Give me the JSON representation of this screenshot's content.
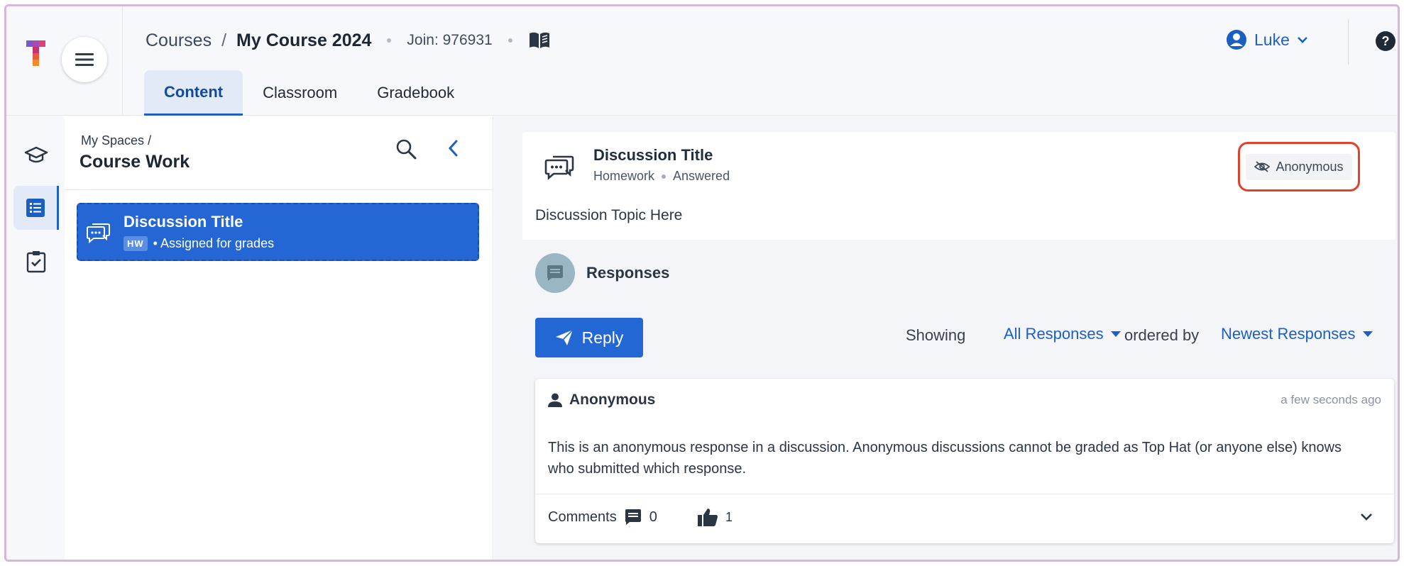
{
  "header": {
    "breadcrumb_courses": "Courses",
    "breadcrumb_sep": "/",
    "course_name": "My Course 2024",
    "join_label": "Join: 976931",
    "user_name": "Luke",
    "icons": [
      "menu-icon",
      "book-icon",
      "user-circle-icon",
      "chevron-down-icon",
      "help-icon"
    ]
  },
  "tabs": [
    {
      "label": "Content",
      "active": true
    },
    {
      "label": "Classroom",
      "active": false
    },
    {
      "label": "Gradebook",
      "active": false
    }
  ],
  "rail": {
    "icons": [
      "graduation-cap-icon",
      "list-icon",
      "clipboard-check-icon"
    ],
    "selected_index": 1
  },
  "panel": {
    "breadcrumb": "My Spaces",
    "breadcrumb_sep": "/",
    "title": "Course Work",
    "item": {
      "title": "Discussion Title",
      "badge": "HW",
      "status": "• Assigned for grades"
    }
  },
  "discussion": {
    "title": "Discussion Title",
    "type": "Homework",
    "state": "Answered",
    "anonymous_label": "Anonymous",
    "topic": "Discussion Topic Here",
    "responses_label": "Responses",
    "reply_label": "Reply",
    "showing_label": "Showing",
    "filter_value": "All Responses",
    "ordered_label": "ordered by",
    "order_value": "Newest Responses"
  },
  "response": {
    "author": "Anonymous",
    "time": "a few seconds ago",
    "body": "This is an anonymous response in a discussion. Anonymous discussions cannot be graded as Top Hat (or anyone else) knows who submitted which response.",
    "comments_label": "Comments",
    "comments_count": "0",
    "likes_count": "1"
  },
  "colors": {
    "accent": "#2267d4",
    "highlight_border": "#e0422b",
    "tab_active_bg": "#e2eaf7"
  }
}
